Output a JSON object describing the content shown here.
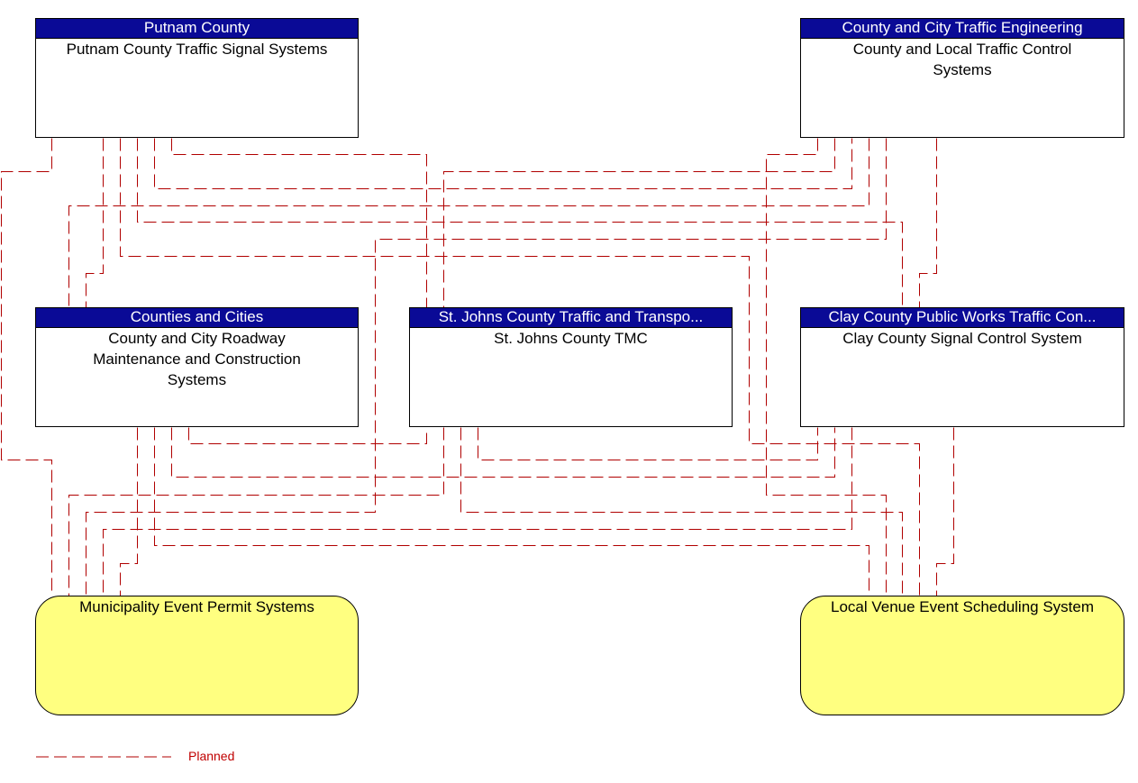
{
  "diagram": {
    "line_color": "#b00000",
    "header_color": "#0a0a96",
    "terminator_color": "#ffff80",
    "nodes": [
      {
        "id": "putnam",
        "header": "Putnam County",
        "body": "Putnam County Traffic Signal Systems"
      },
      {
        "id": "county-city-eng",
        "header": "County and City Traffic Engineering",
        "body": "County and Local Traffic Control Systems"
      },
      {
        "id": "counties-cities",
        "header": "Counties and Cities",
        "body": "County and City Roadway Maintenance and Construction Systems"
      },
      {
        "id": "st-johns",
        "header": "St. Johns County Traffic and Transpo...",
        "body": "St. Johns County TMC"
      },
      {
        "id": "clay",
        "header": "Clay County Public Works Traffic Con...",
        "body": "Clay County Signal Control System"
      }
    ],
    "terminators": [
      {
        "id": "municipality",
        "label": "Municipality Event Permit Systems"
      },
      {
        "id": "local-venue",
        "label": "Local Venue Event Scheduling System"
      }
    ],
    "flows": [
      {
        "from": "putnam",
        "to": "municipality",
        "status": "Planned"
      },
      {
        "from": "putnam",
        "to": "counties-cities",
        "status": "Planned"
      },
      {
        "from": "putnam",
        "to": "st-johns",
        "status": "Planned"
      },
      {
        "from": "putnam",
        "to": "county-city-eng",
        "status": "Planned"
      },
      {
        "from": "putnam",
        "to": "clay",
        "status": "Planned"
      },
      {
        "from": "putnam",
        "to": "local-venue",
        "status": "Planned"
      },
      {
        "from": "county-city-eng",
        "to": "st-johns",
        "status": "Planned"
      },
      {
        "from": "county-city-eng",
        "to": "counties-cities",
        "status": "Planned"
      },
      {
        "from": "county-city-eng",
        "to": "municipality",
        "status": "Planned"
      },
      {
        "from": "county-city-eng",
        "to": "clay",
        "status": "Planned"
      },
      {
        "from": "county-city-eng",
        "to": "local-venue",
        "status": "Planned"
      },
      {
        "from": "counties-cities",
        "to": "st-johns",
        "status": "Planned"
      },
      {
        "from": "counties-cities",
        "to": "clay",
        "status": "Planned"
      },
      {
        "from": "counties-cities",
        "to": "municipality",
        "status": "Planned"
      },
      {
        "from": "counties-cities",
        "to": "local-venue",
        "status": "Planned"
      },
      {
        "from": "st-johns",
        "to": "municipality",
        "status": "Planned"
      },
      {
        "from": "st-johns",
        "to": "clay",
        "status": "Planned"
      },
      {
        "from": "st-johns",
        "to": "local-venue",
        "status": "Planned"
      },
      {
        "from": "clay",
        "to": "municipality",
        "status": "Planned"
      },
      {
        "from": "clay",
        "to": "local-venue",
        "status": "Planned"
      }
    ]
  },
  "legend": {
    "planned_label": "Planned"
  }
}
